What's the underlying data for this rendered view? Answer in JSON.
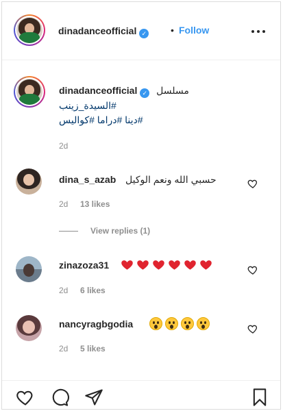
{
  "header": {
    "username": "dinadanceofficial",
    "separator": "•",
    "follow_label": "Follow",
    "more_icon": "more-horizontal-icon"
  },
  "caption": {
    "username": "dinadanceofficial",
    "text": "مسلسل",
    "hashtags_line1": "#السيدة_زينب",
    "hashtags_line2": "#دينا #دراما #كواليس",
    "time": "2d"
  },
  "comments": [
    {
      "username": "dina_s_azab",
      "text": "حسبي الله ونعم الوكيل",
      "time": "2d",
      "likes": "13 likes",
      "view_replies": "View replies (1)"
    },
    {
      "username": "zinazoza31",
      "emoji": "red-heart x6",
      "time": "2d",
      "likes": "6 likes"
    },
    {
      "username": "nancyragbgodia",
      "emoji": "astonished-face x4",
      "time": "2d",
      "likes": "5 likes"
    }
  ],
  "actions": {
    "like_icon": "heart-icon",
    "comment_icon": "comment-icon",
    "share_icon": "send-icon",
    "save_icon": "bookmark-icon"
  },
  "colors": {
    "link": "#3897f0",
    "hashtag": "#00376b",
    "muted": "#8e8e8e",
    "text": "#262626",
    "verified": "#3897f0"
  }
}
